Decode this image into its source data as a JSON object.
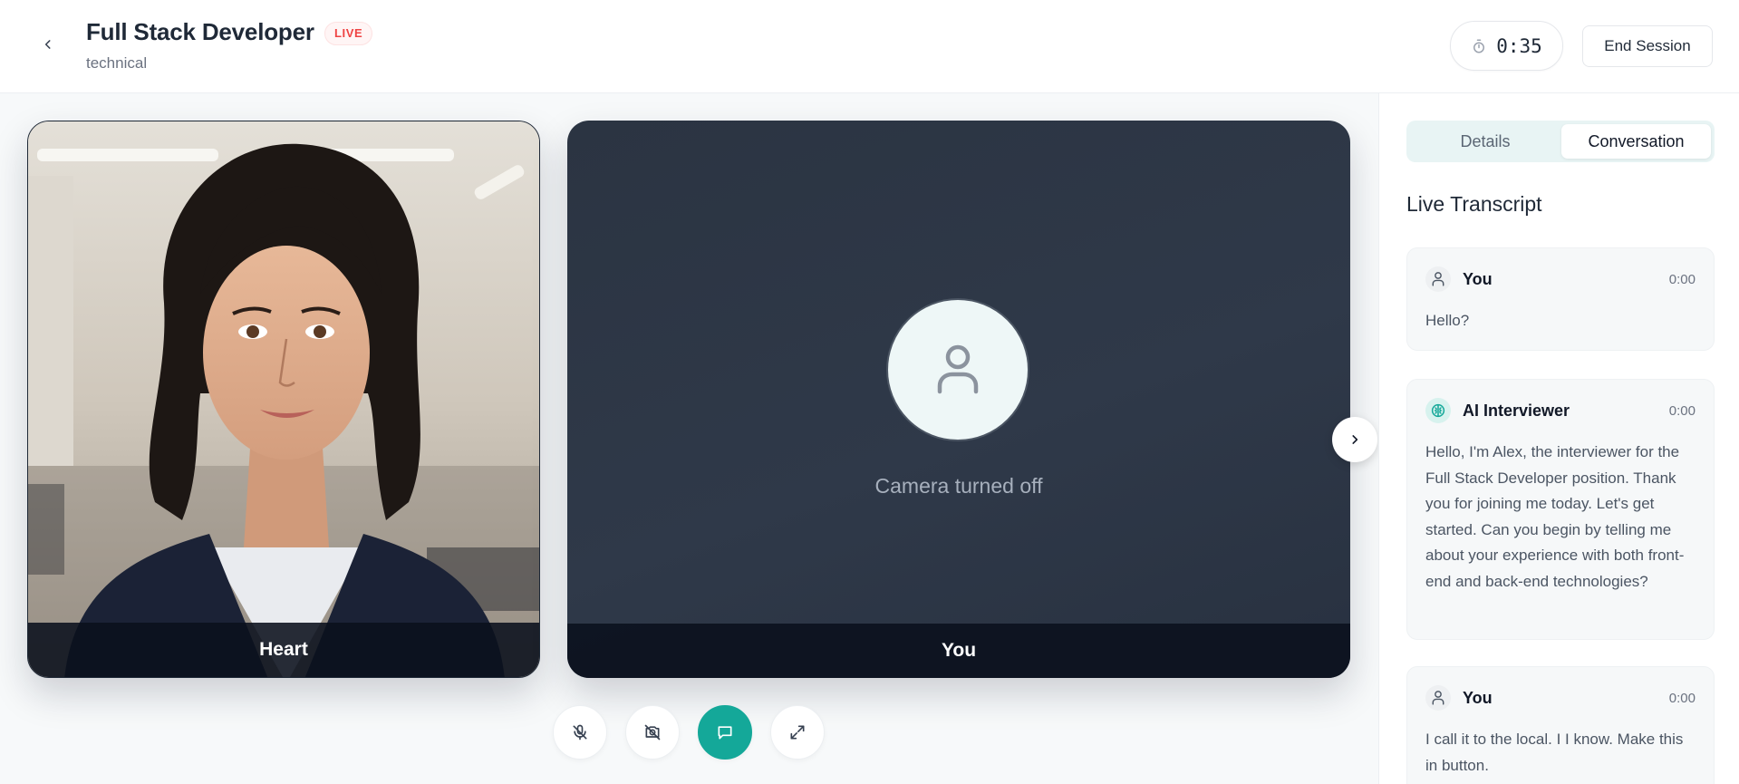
{
  "header": {
    "title": "Full Stack Developer",
    "badge": "LIVE",
    "subtitle": "technical",
    "timer": "0:35",
    "end_session": "End Session"
  },
  "stage": {
    "interviewer_name": "Heart",
    "candidate_name": "You",
    "camera_status": "Camera turned off"
  },
  "controls": {
    "icons": [
      "mic-off-icon",
      "camera-off-icon",
      "chat-icon",
      "expand-icon"
    ],
    "active": "chat-icon"
  },
  "sidebar": {
    "tabs": [
      {
        "label": "Details",
        "active": false
      },
      {
        "label": "Conversation",
        "active": true
      }
    ],
    "section_title": "Live Transcript",
    "messages": [
      {
        "speaker": "You",
        "time": "0:00",
        "text": "Hello?"
      },
      {
        "speaker": "AI Interviewer",
        "time": "0:00",
        "text": "Hello, I'm Alex, the interviewer for the Full Stack Developer position. Thank you for joining me today. Let's get started. Can you begin by telling me about your experience with both front-end and back-end technologies?"
      },
      {
        "speaker": "You",
        "time": "0:00",
        "text": "I call it to the local. I I know. Make this in button."
      }
    ]
  },
  "colors": {
    "accent": "#14a899",
    "live": "#ef4444",
    "tile_dark": "#2b3442"
  }
}
